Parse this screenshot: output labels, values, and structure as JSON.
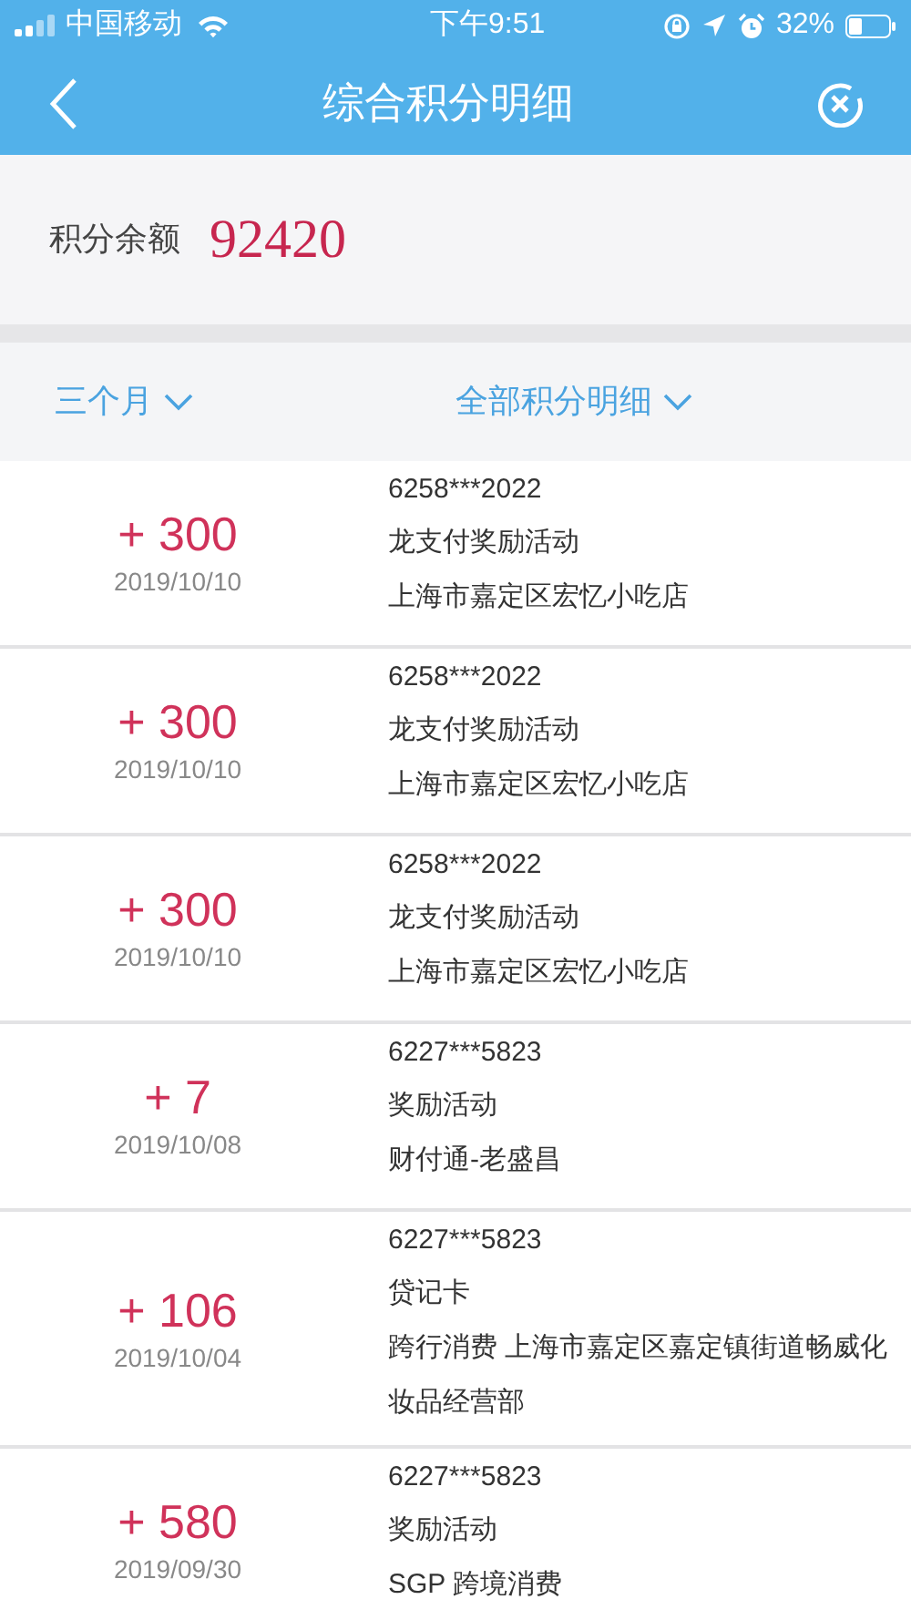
{
  "status_bar": {
    "carrier": "中国移动",
    "time": "下午9:51",
    "battery": "32%"
  },
  "nav": {
    "title": "综合积分明细"
  },
  "balance": {
    "label": "积分余额",
    "value": "92420"
  },
  "filters": [
    {
      "label": "三个月"
    },
    {
      "label": "全部积分明细"
    }
  ],
  "records": [
    {
      "points": "+ 300",
      "date": "2019/10/10",
      "lines": [
        "6258***2022",
        "龙支付奖励活动",
        "上海市嘉定区宏忆小吃店"
      ]
    },
    {
      "points": "+ 300",
      "date": "2019/10/10",
      "lines": [
        "6258***2022",
        "龙支付奖励活动",
        "上海市嘉定区宏忆小吃店"
      ]
    },
    {
      "points": "+ 300",
      "date": "2019/10/10",
      "lines": [
        "6258***2022",
        "龙支付奖励活动",
        "上海市嘉定区宏忆小吃店"
      ]
    },
    {
      "points": "+ 7",
      "date": "2019/10/08",
      "lines": [
        "6227***5823",
        "奖励活动",
        "财付通-老盛昌"
      ]
    },
    {
      "points": "+ 106",
      "date": "2019/10/04",
      "lines": [
        "6227***5823",
        "贷记卡",
        "跨行消费 上海市嘉定区嘉定镇街道畅威化妆品经营部"
      ]
    },
    {
      "points": "+ 580",
      "date": "2019/09/30",
      "lines": [
        "6227***5823",
        "奖励活动",
        "SGP 跨境消费"
      ]
    }
  ]
}
